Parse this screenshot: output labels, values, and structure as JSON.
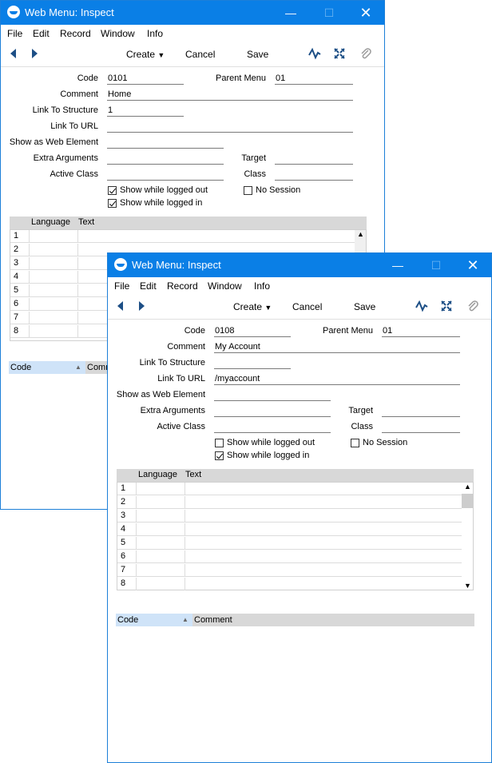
{
  "colors": {
    "titlebar": "#0a7fe6",
    "accent": "#1d7fd8",
    "sort_column": "#cfe3f8",
    "grid_header": "#d8d8d8"
  },
  "icons": {
    "app": "app-logo-icon",
    "prev": "triangle-left-icon",
    "next": "triangle-right-icon",
    "activity": "activity-icon",
    "fullscreen": "expand-icon",
    "attach": "paperclip-icon"
  },
  "back_window": {
    "title": "Web Menu: Inspect",
    "menu": [
      "File",
      "Edit",
      "Record",
      "Window",
      "Info"
    ],
    "toolbar": {
      "create": "Create",
      "cancel": "Cancel",
      "save": "Save"
    },
    "labels": {
      "code": "Code",
      "parent_menu": "Parent Menu",
      "comment": "Comment",
      "link_to_structure": "Link To Structure",
      "link_to_url": "Link To URL",
      "show_as_web_element": "Show as Web Element",
      "extra_arguments": "Extra Arguments",
      "target": "Target",
      "active_class": "Active Class",
      "class": "Class"
    },
    "values": {
      "code": "0101",
      "parent_menu": "01",
      "comment": "Home",
      "link_to_structure": "1",
      "link_to_url": "",
      "show_as_web_element": "",
      "extra_arguments": "",
      "target": "",
      "active_class": "",
      "class": ""
    },
    "checkboxes": {
      "show_logged_out": "Show while logged out",
      "show_logged_out_checked": true,
      "no_session": "No Session",
      "no_session_checked": false,
      "show_logged_in": "Show while logged in",
      "show_logged_in_checked": true
    },
    "grid": {
      "col_language": "Language",
      "col_text": "Text",
      "rows": [
        "1",
        "2",
        "3",
        "4",
        "5",
        "6",
        "7",
        "8"
      ]
    },
    "list": {
      "col_code": "Code",
      "col_comment": "Comm"
    }
  },
  "front_window": {
    "title": "Web Menu: Inspect",
    "menu": [
      "File",
      "Edit",
      "Record",
      "Window",
      "Info"
    ],
    "toolbar": {
      "create": "Create",
      "cancel": "Cancel",
      "save": "Save"
    },
    "labels": {
      "code": "Code",
      "parent_menu": "Parent Menu",
      "comment": "Comment",
      "link_to_structure": "Link To Structure",
      "link_to_url": "Link To URL",
      "show_as_web_element": "Show as Web Element",
      "extra_arguments": "Extra Arguments",
      "target": "Target",
      "active_class": "Active Class",
      "class": "Class"
    },
    "values": {
      "code": "0108",
      "parent_menu": "01",
      "comment": "My Account",
      "link_to_structure": "",
      "link_to_url": "/myaccount",
      "show_as_web_element": "",
      "extra_arguments": "",
      "target": "",
      "active_class": "",
      "class": ""
    },
    "checkboxes": {
      "show_logged_out": "Show while logged out",
      "show_logged_out_checked": false,
      "no_session": "No Session",
      "no_session_checked": false,
      "show_logged_in": "Show while logged in",
      "show_logged_in_checked": true
    },
    "grid": {
      "col_language": "Language",
      "col_text": "Text",
      "rows": [
        "1",
        "2",
        "3",
        "4",
        "5",
        "6",
        "7",
        "8"
      ]
    },
    "list": {
      "col_code": "Code",
      "col_comment": "Comment"
    }
  }
}
